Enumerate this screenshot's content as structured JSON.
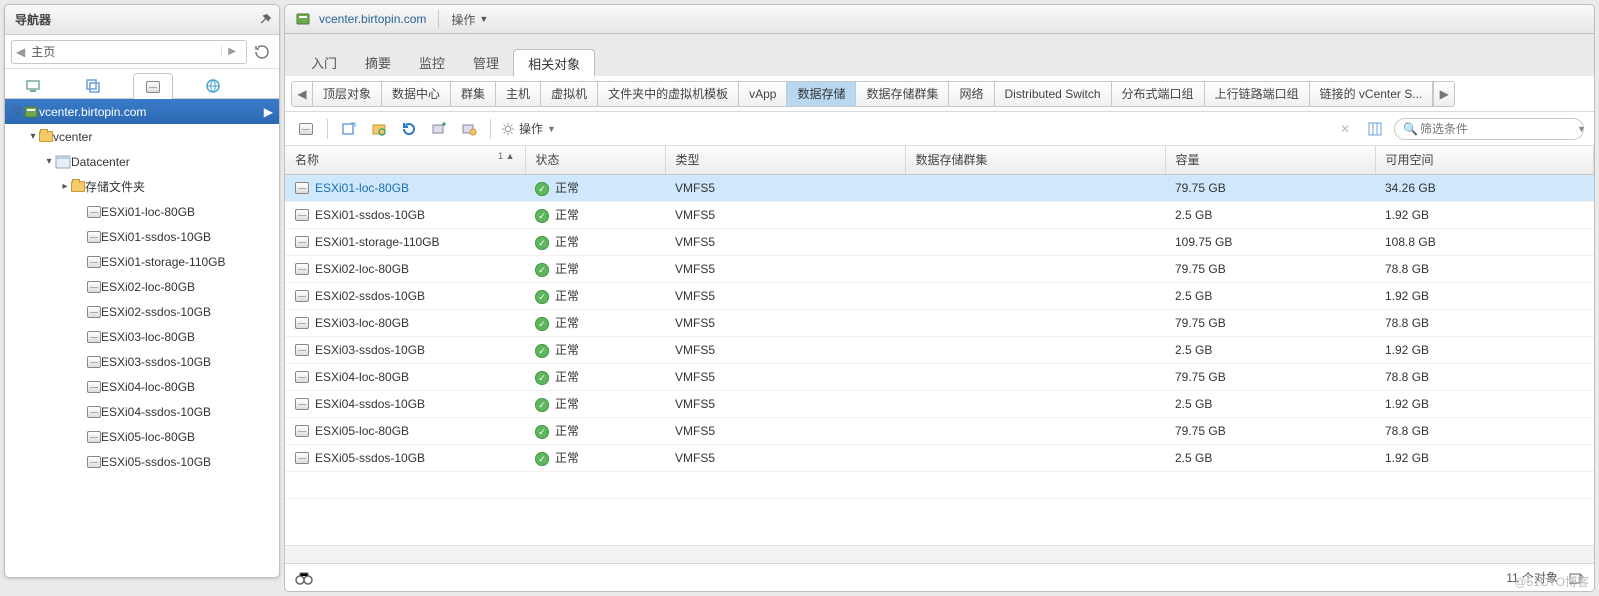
{
  "navigator": {
    "title": "导航器",
    "breadcrumb": "主页",
    "tree_root": "vcenter.birtopin.com",
    "nodes": {
      "vcenter_folder": "vcenter",
      "datacenter": "Datacenter",
      "storage_folder": "存储文件夹"
    },
    "datastores": [
      "ESXi01-loc-80GB",
      "ESXi01-ssdos-10GB",
      "ESXi01-storage-110GB",
      "ESXi02-loc-80GB",
      "ESXi02-ssdos-10GB",
      "ESXi03-loc-80GB",
      "ESXi03-ssdos-10GB",
      "ESXi04-loc-80GB",
      "ESXi04-ssdos-10GB",
      "ESXi05-loc-80GB",
      "ESXi05-ssdos-10GB"
    ]
  },
  "header": {
    "title": "vcenter.birtopin.com",
    "actions_label": "操作"
  },
  "main_tabs": {
    "t0": "入门",
    "t1": "摘要",
    "t2": "监控",
    "t3": "管理",
    "t4": "相关对象"
  },
  "sub_tabs": [
    "顶层对象",
    "数据中心",
    "群集",
    "主机",
    "虚拟机",
    "文件夹中的虚拟机模板",
    "vApp",
    "数据存储",
    "数据存储群集",
    "网络",
    "Distributed Switch",
    "分布式端口组",
    "上行链路端口组",
    "链接的 vCenter S..."
  ],
  "sub_active_index": 7,
  "toolbar": {
    "actions": "操作"
  },
  "filter": {
    "placeholder": "筛选条件"
  },
  "grid": {
    "columns": {
      "name": "名称",
      "status": "状态",
      "type": "类型",
      "cluster": "数据存储群集",
      "capacity": "容量",
      "free": "可用空间"
    },
    "sort_indicator": "1 ▲",
    "rows": [
      {
        "name": "ESXi01-loc-80GB",
        "status": "正常",
        "type": "VMFS5",
        "cluster": "",
        "capacity": "79.75  GB",
        "free": "34.26  GB",
        "selected": true
      },
      {
        "name": "ESXi01-ssdos-10GB",
        "status": "正常",
        "type": "VMFS5",
        "cluster": "",
        "capacity": "2.5  GB",
        "free": "1.92  GB"
      },
      {
        "name": "ESXi01-storage-110GB",
        "status": "正常",
        "type": "VMFS5",
        "cluster": "",
        "capacity": "109.75  GB",
        "free": "108.8  GB"
      },
      {
        "name": "ESXi02-loc-80GB",
        "status": "正常",
        "type": "VMFS5",
        "cluster": "",
        "capacity": "79.75  GB",
        "free": "78.8  GB"
      },
      {
        "name": "ESXi02-ssdos-10GB",
        "status": "正常",
        "type": "VMFS5",
        "cluster": "",
        "capacity": "2.5  GB",
        "free": "1.92  GB"
      },
      {
        "name": "ESXi03-loc-80GB",
        "status": "正常",
        "type": "VMFS5",
        "cluster": "",
        "capacity": "79.75  GB",
        "free": "78.8  GB"
      },
      {
        "name": "ESXi03-ssdos-10GB",
        "status": "正常",
        "type": "VMFS5",
        "cluster": "",
        "capacity": "2.5  GB",
        "free": "1.92  GB"
      },
      {
        "name": "ESXi04-loc-80GB",
        "status": "正常",
        "type": "VMFS5",
        "cluster": "",
        "capacity": "79.75  GB",
        "free": "78.8  GB"
      },
      {
        "name": "ESXi04-ssdos-10GB",
        "status": "正常",
        "type": "VMFS5",
        "cluster": "",
        "capacity": "2.5  GB",
        "free": "1.92  GB"
      },
      {
        "name": "ESXi05-loc-80GB",
        "status": "正常",
        "type": "VMFS5",
        "cluster": "",
        "capacity": "79.75  GB",
        "free": "78.8  GB"
      },
      {
        "name": "ESXi05-ssdos-10GB",
        "status": "正常",
        "type": "VMFS5",
        "cluster": "",
        "capacity": "2.5  GB",
        "free": "1.92  GB"
      }
    ]
  },
  "status_bar": {
    "count_label": "11 个对象"
  },
  "watermark": "@51CTO博客"
}
